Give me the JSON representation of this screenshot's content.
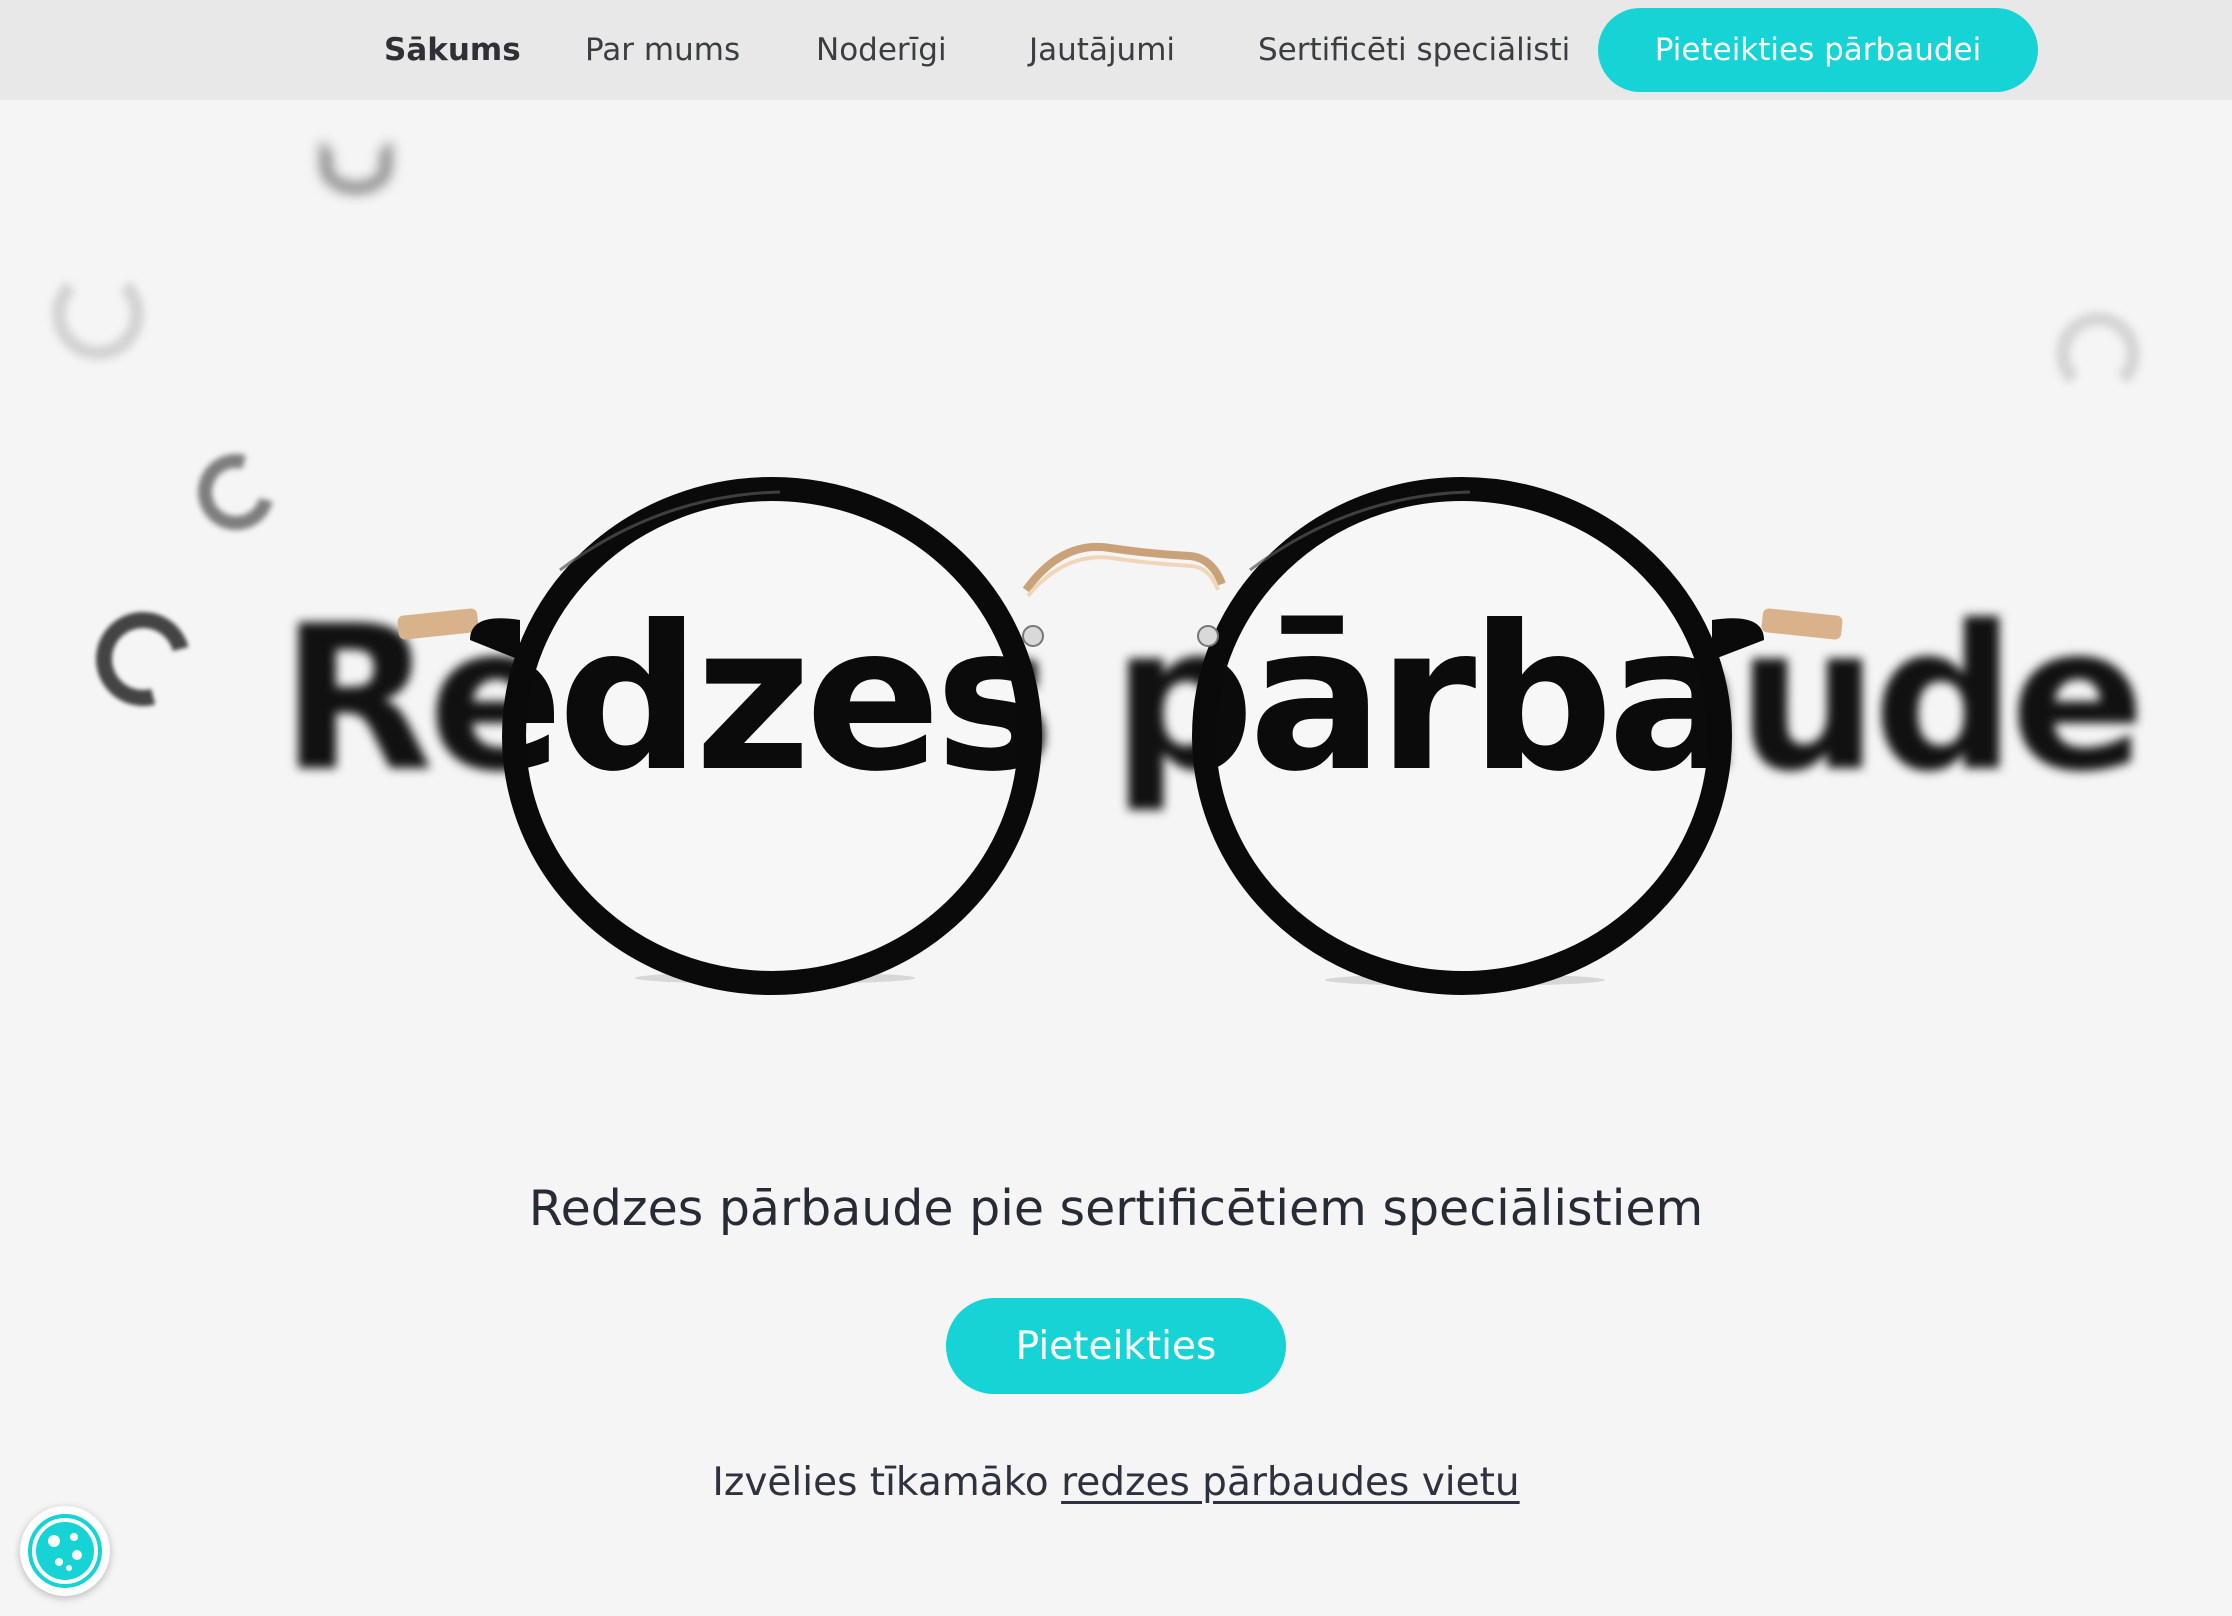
{
  "nav": {
    "items": [
      {
        "label": "Sākums",
        "active": true
      },
      {
        "label": "Par mums",
        "active": false
      },
      {
        "label": "Noderīgi",
        "active": false
      },
      {
        "label": "Jautājumi",
        "active": false
      },
      {
        "label": "Sertificēti speciālisti",
        "active": false
      }
    ],
    "cta_label": "Pieteikties pārbaudei"
  },
  "hero": {
    "image_text": "Redzes pārbaude",
    "tagline": "Redzes pārbaude pie sertificētiem speciālistiem",
    "cta_label": "Pieteikties",
    "choose_prefix": "Izvēlies tīkamāko",
    "choose_link": "redzes pārbaudes vietu"
  },
  "cookie": {
    "icon": "cookie-icon"
  },
  "colors": {
    "accent": "#16d3d6",
    "topbar": "#e8e8e8",
    "background": "#f5f5f5",
    "text": "#262b36"
  }
}
